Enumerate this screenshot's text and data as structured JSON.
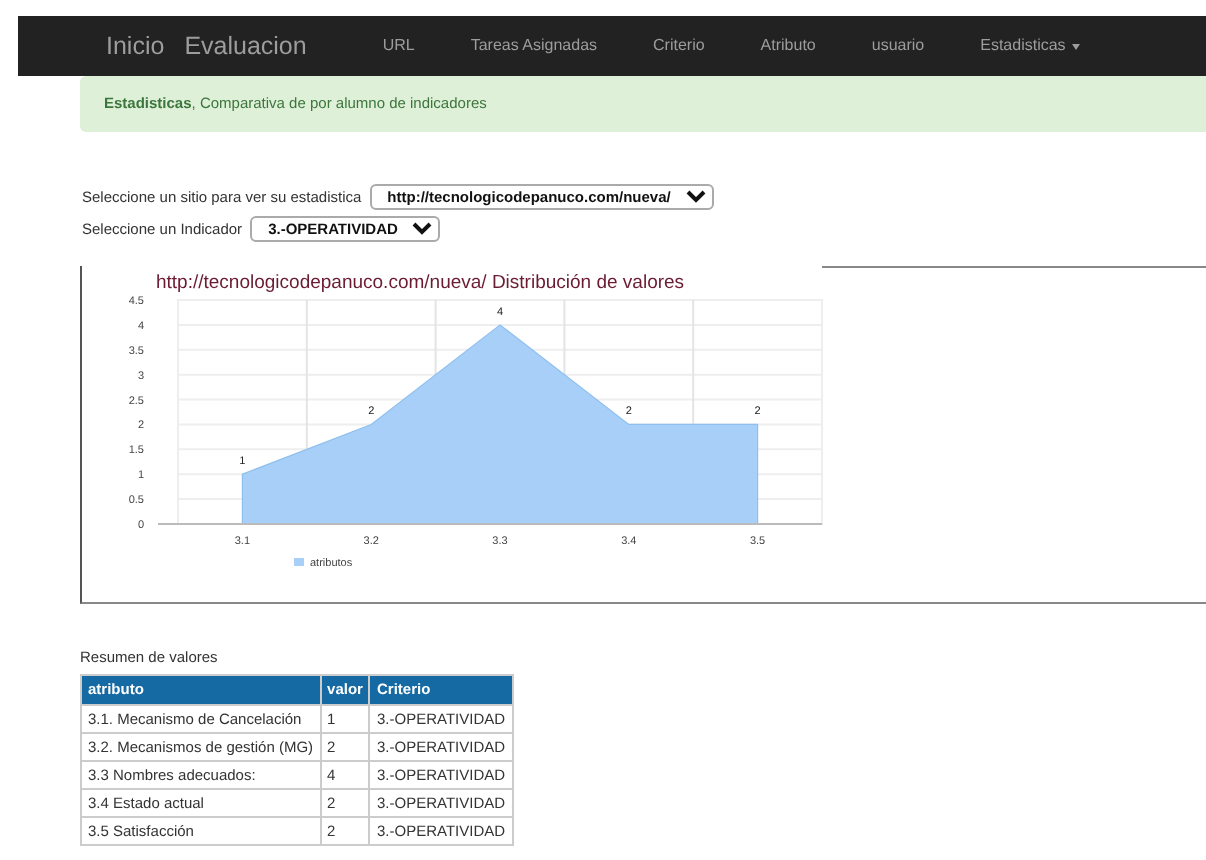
{
  "navbar": {
    "brand": [
      "Inicio",
      "Evaluacion"
    ],
    "items": [
      {
        "label": "URL",
        "dropdown": false
      },
      {
        "label": "Tareas Asignadas",
        "dropdown": false
      },
      {
        "label": "Criterio",
        "dropdown": false
      },
      {
        "label": "Atributo",
        "dropdown": false
      },
      {
        "label": "usuario",
        "dropdown": false
      },
      {
        "label": "Estadisticas",
        "dropdown": true
      }
    ]
  },
  "alert": {
    "text": "**Estadisticas**, Comparativa de por alumno de indicadores"
  },
  "filters": [
    {
      "label": "Seleccione un sitio para ver su estadistica",
      "value": "http://tecnologicodepanuco.com/nueva/"
    },
    {
      "label": "Seleccione un Indicador",
      "value": "3.-OPERATIVIDAD"
    }
  ],
  "chart": {
    "chart_data": {
      "type": "area",
      "title": "http://tecnologicodepanuco.com/nueva/ Distribución de valores",
      "categories": [
        "3.1",
        "3.2",
        "3.3",
        "3.4",
        "3.5"
      ],
      "series": [
        {
          "name": "atributos",
          "color": "#a7cff7",
          "values": [
            1,
            2,
            4,
            2,
            2
          ]
        }
      ],
      "ylim": [
        0,
        4.5
      ],
      "yticks": [
        0,
        0.5,
        1,
        1.5,
        2,
        2.5,
        3,
        3.5,
        4,
        4.5
      ],
      "data_labels": true,
      "grid": true
    }
  },
  "summary": {
    "title": "Resumen de valores",
    "columns": [
      "atributo",
      "valor",
      "Criterio"
    ],
    "rows": [
      [
        "3.1. Mecanismo de Cancelación",
        "1",
        "3.-OPERATIVIDAD"
      ],
      [
        "3.2. Mecanismos de gestión (MG)",
        "2",
        "3.-OPERATIVIDAD"
      ],
      [
        "3.3 Nombres adecuados:",
        "4",
        "3.-OPERATIVIDAD"
      ],
      [
        "3.4 Estado actual",
        "2",
        "3.-OPERATIVIDAD"
      ],
      [
        "3.5 Satisfacción",
        "2",
        "3.-OPERATIVIDAD"
      ]
    ]
  }
}
